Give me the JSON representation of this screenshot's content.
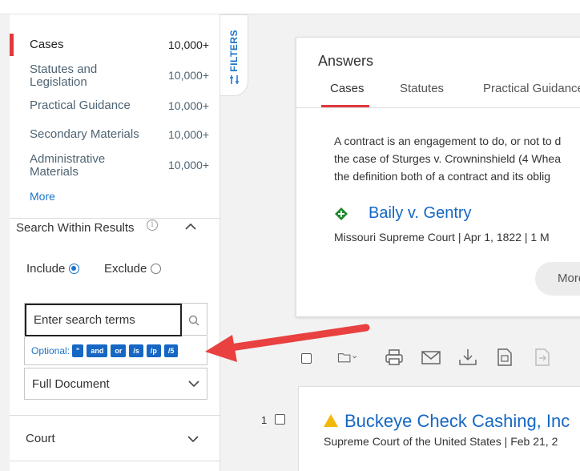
{
  "content_types": [
    {
      "label": "Cases",
      "count": "10,000+",
      "active": true
    },
    {
      "label": "Statutes and Legislation",
      "count": "10,000+"
    },
    {
      "label": "Practical Guidance",
      "count": "10,000+"
    },
    {
      "label": "Secondary Materials",
      "count": "10,000+"
    },
    {
      "label": "Administrative Materials",
      "count": "10,000+"
    }
  ],
  "content_types_more": "More",
  "filters_tab": "FILTERS",
  "search_within": {
    "title": "Search Within Results",
    "include_label": "Include",
    "exclude_label": "Exclude",
    "include_selected": true,
    "placeholder": "Enter search terms",
    "optional_label": "Optional:",
    "connectors": [
      "\"",
      "and",
      "or",
      "/s",
      "/p",
      "/5"
    ],
    "scope_selected": "Full Document"
  },
  "court_title": "Court",
  "answers": {
    "title": "Answers",
    "tabs": [
      "Cases",
      "Statutes",
      "Practical Guidance"
    ],
    "active_tab": "Cases",
    "lines": [
      "A contract is an engagement to do, or not to d",
      "the case of Sturges v. Crowninshield (4 Whea",
      "the definition both of a contract and its oblig"
    ],
    "case_title": "Baily v. Gentry",
    "case_meta": "Missouri Supreme Court  |  Apr 1, 1822  |  1 M",
    "more_label": "More"
  },
  "result": {
    "number": "1",
    "title": "Buckeye Check Cashing, Inc",
    "meta": "Supreme Court of the United States  |  Feb 21, 2"
  },
  "colors": {
    "accent_red": "#e0393e",
    "link_blue": "#1667c4",
    "warning_yellow": "#f2b90a",
    "positive_green": "#1e8a2e"
  },
  "icons": [
    "info-icon",
    "chevron-up-icon",
    "chevron-down-icon",
    "search-icon",
    "filters-icon",
    "folder-icon",
    "print-icon",
    "email-icon",
    "download-icon",
    "document-icon",
    "export-icon",
    "green-diamond-icon",
    "warning-icon"
  ]
}
